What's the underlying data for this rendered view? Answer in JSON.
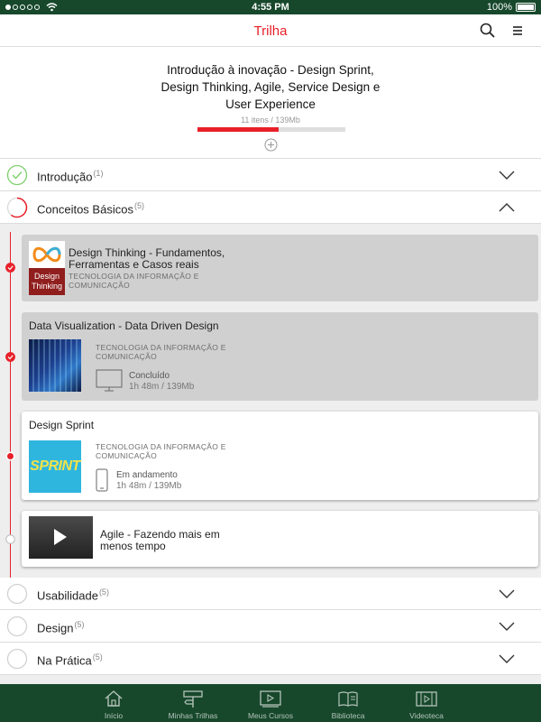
{
  "status_bar": {
    "time": "4:55 PM",
    "battery": "100%",
    "signal_icon": "signal-dots-icon",
    "wifi_icon": "wifi-icon"
  },
  "header": {
    "title": "Trilha",
    "search_icon": "search-icon",
    "menu_icon": "hamburger-menu-icon"
  },
  "course": {
    "title": "Introdução à inovação - Design Sprint, Design Thinking, Agile, Service Design e User Experience",
    "meta": "11 itens / 139Mb",
    "progress": 0.55,
    "add_icon": "plus-circle-icon"
  },
  "sections": [
    {
      "label": "Introdução",
      "count": "(1)",
      "state": "complete",
      "expanded": false
    },
    {
      "label": "Conceitos Básicos",
      "count": "(5)",
      "state": "in-progress",
      "expanded": true
    },
    {
      "label": "Usabilidade",
      "count": "(5)",
      "state": "empty",
      "expanded": false
    },
    {
      "label": "Design",
      "count": "(5)",
      "state": "empty",
      "expanded": false
    },
    {
      "label": "Na Prática",
      "count": "(5)",
      "state": "empty",
      "expanded": false
    }
  ],
  "items": [
    {
      "title": "Design Thinking - Fundamentos, Ferramentas e Casos reais",
      "category": "TECNOLOGIA DA INFORMAÇÃO E COMUNICAÇÃO",
      "thumb_text": "Design Thinking",
      "state": "done"
    },
    {
      "title": "Data Visualization - Data Driven Design",
      "category": "TECNOLOGIA DA INFORMAÇÃO E COMUNICAÇÃO",
      "status": "Concluído",
      "duration": "1h 48m / 139Mb",
      "device_icon": "monitor-icon",
      "state": "done"
    },
    {
      "title": "Design Sprint",
      "category": "TECNOLOGIA DA INFORMAÇÃO E COMUNICAÇÃO",
      "status": "Em andamento",
      "duration": "1h 48m / 139Mb",
      "device_icon": "phone-icon",
      "thumb_text": "SPRINT",
      "state": "current"
    },
    {
      "title": "Agile - Fazendo mais em menos tempo",
      "state": "pending",
      "thumb_icon": "play-icon"
    }
  ],
  "colors": {
    "accent": "#e8202a",
    "nav_bg": "#17482c",
    "complete": "#7ccf6a"
  },
  "bottom_nav": [
    {
      "label": "Início",
      "icon": "home-icon"
    },
    {
      "label": "Minhas Trilhas",
      "icon": "signpost-icon"
    },
    {
      "label": "Meus Cursos",
      "icon": "video-list-icon"
    },
    {
      "label": "Biblioteca",
      "icon": "library-icon"
    },
    {
      "label": "Videoteca",
      "icon": "film-icon"
    }
  ]
}
